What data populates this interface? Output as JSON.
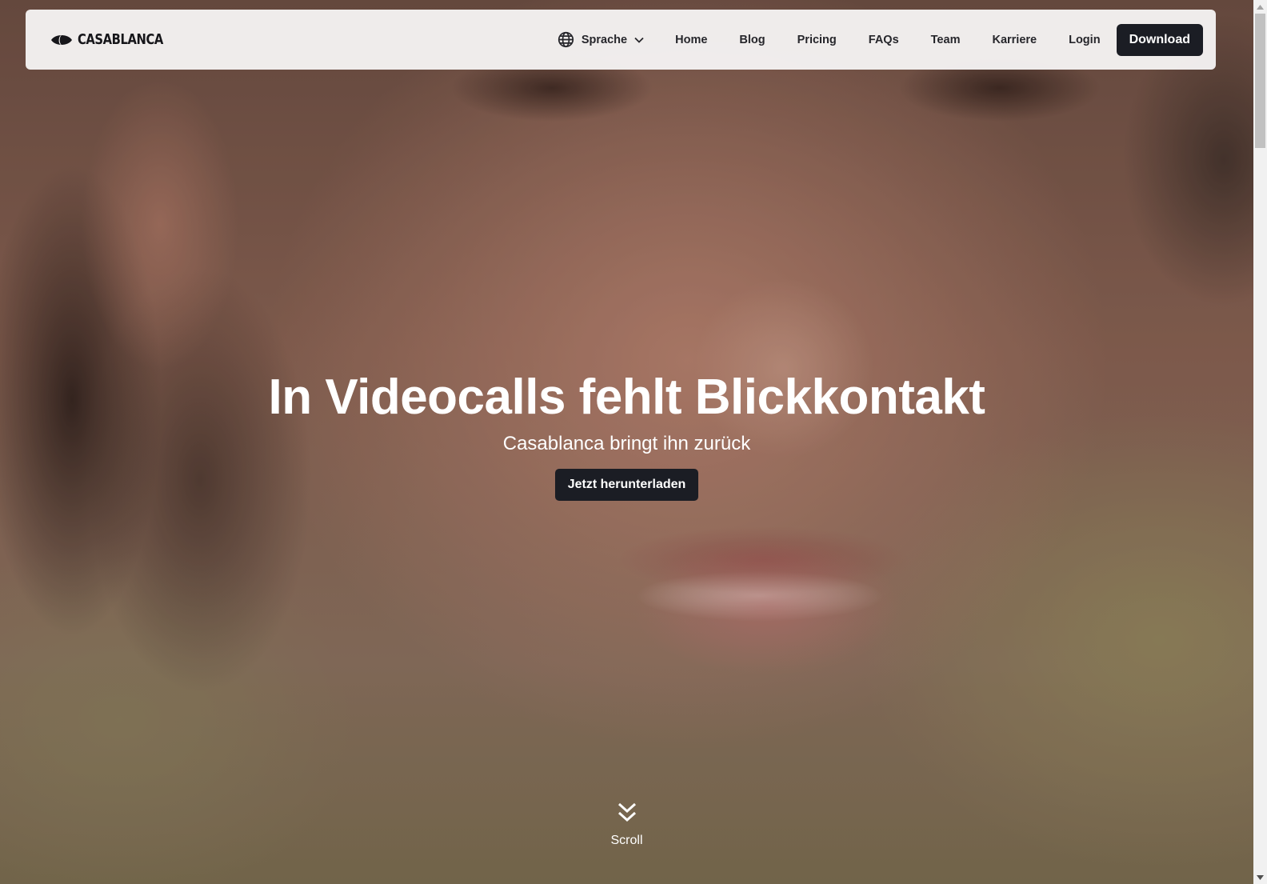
{
  "brand": {
    "name": "CASABLANCA",
    "logo_icon": "eye-icon"
  },
  "nav": {
    "language": {
      "label": "Sprache",
      "icon": "globe-icon",
      "caret": "chevron-down-icon"
    },
    "links": [
      "Home",
      "Blog",
      "Pricing",
      "FAQs",
      "Team",
      "Karriere",
      "Login"
    ],
    "download_label": "Download"
  },
  "hero": {
    "headline": "In Videocalls fehlt Blickkontakt",
    "subline": "Casablanca bringt ihn zurück",
    "cta_label": "Jetzt herunterladen",
    "scroll_label": "Scroll",
    "scroll_icon": "double-chevron-down-icon"
  },
  "colors": {
    "button_bg": "#1b1d24",
    "navbar_bg": "#f5f2f2",
    "text_dark": "#26262b"
  }
}
